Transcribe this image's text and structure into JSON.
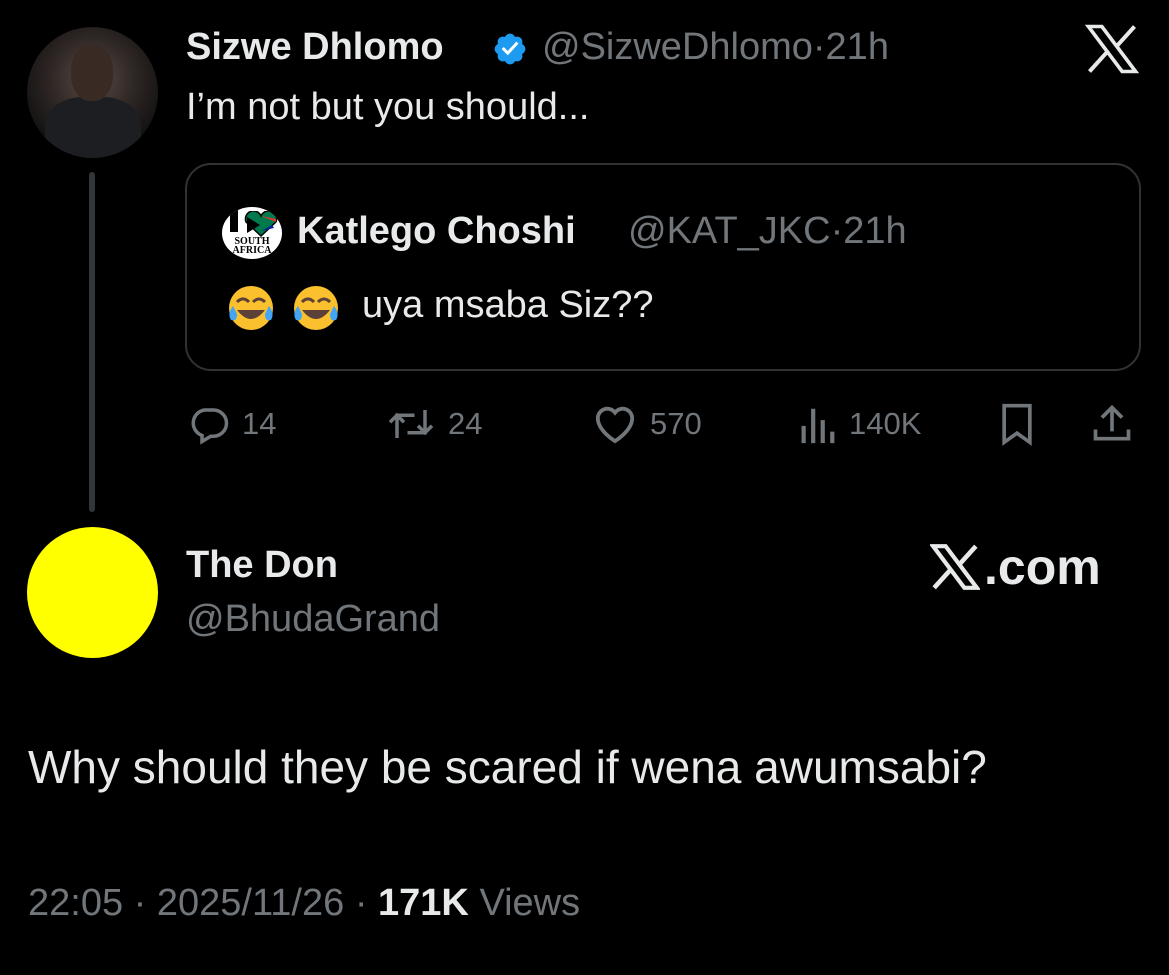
{
  "top_tweet": {
    "author_name": "Sizwe Dhlomo",
    "handle": "@SizweDhlomo",
    "separator": "·",
    "time": "21h",
    "text": "I’m not but you should...",
    "icons": {
      "verified": "verified-badge-icon",
      "platform": "x-logo-icon"
    },
    "accent_color": "#1d9bf0"
  },
  "quoted_tweet": {
    "author_name": "Katlego Choshi",
    "handle": "@KAT_JKC",
    "separator": "·",
    "time": "21h",
    "avatar_text": "SOUTH AFRICA",
    "emojis": [
      "😂",
      "😂"
    ],
    "text": "uya msaba Siz??"
  },
  "actions": {
    "replies": "14",
    "reposts": "24",
    "likes": "570",
    "views": "140K",
    "icons": [
      "reply-icon",
      "repost-icon",
      "like-icon",
      "views-icon",
      "bookmark-icon",
      "share-icon"
    ]
  },
  "reply": {
    "author_name": "The Don",
    "handle": "@BhudaGrand",
    "avatar_color": "#ffff00",
    "watermark": ".com",
    "text": "Why should they be scared if wena awumsabi?"
  },
  "meta": {
    "time": "22:05",
    "separator": "·",
    "date": "2025/11/26",
    "views_count": "171K",
    "views_label": "Views"
  }
}
